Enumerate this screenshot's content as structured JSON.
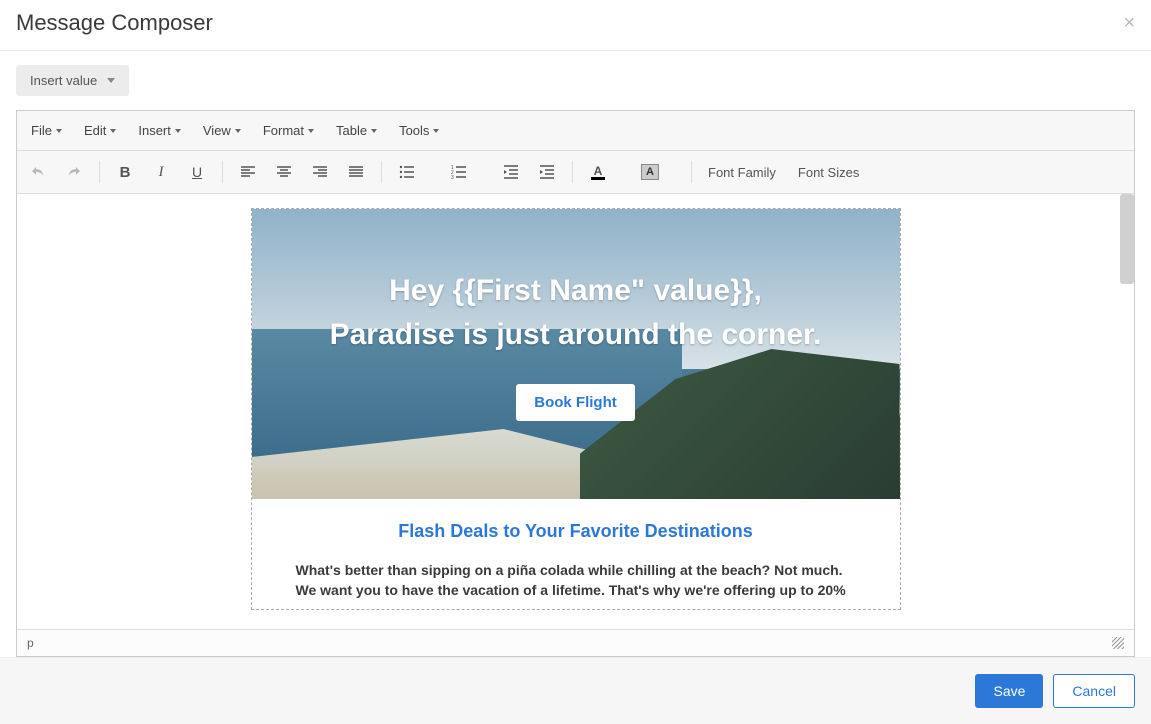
{
  "header": {
    "title": "Message Composer"
  },
  "insert_value_label": "Insert value",
  "menubar": {
    "items": [
      "File",
      "Edit",
      "Insert",
      "View",
      "Format",
      "Table",
      "Tools"
    ]
  },
  "toolbar": {
    "font_family_label": "Font Family",
    "font_sizes_label": "Font Sizes",
    "text_color_letter": "A",
    "bg_color_letter": "A"
  },
  "email": {
    "hero_line1": "Hey {{First Name\" value}},",
    "hero_line2": "Paradise is just around the corner.",
    "book_button": "Book Flight",
    "deals_title": "Flash Deals to Your Favorite Destinations",
    "body_line1": "What's better than sipping on a piña colada while chilling at the beach? Not much.",
    "body_line2": "We want you to have the vacation of a lifetime. That's why we're offering up to 20%"
  },
  "statusbar": {
    "path": "p"
  },
  "footer": {
    "save": "Save",
    "cancel": "Cancel"
  },
  "colors": {
    "accent": "#2b78d9"
  }
}
